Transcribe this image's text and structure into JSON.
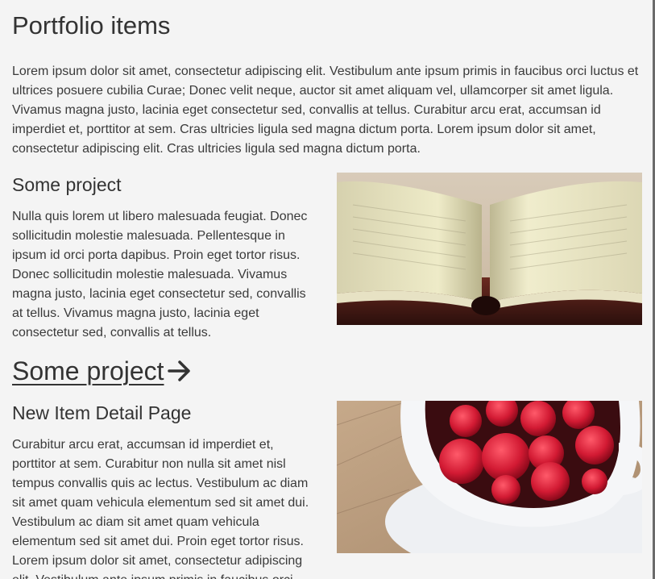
{
  "page": {
    "title": "Portfolio items",
    "intro": "Lorem ipsum dolor sit amet, consectetur adipiscing elit. Vestibulum ante ipsum primis in faucibus orci luctus et ultrices posuere cubilia Curae; Donec velit neque, auctor sit amet aliquam vel, ullamcorper sit amet ligula. Vivamus magna justo, lacinia eget consectetur sed, convallis at tellus. Curabitur arcu erat, accumsan id imperdiet et, porttitor at sem. Cras ultricies ligula sed magna dictum porta. Lorem ipsum dolor sit amet, consectetur adipiscing elit. Cras ultricies ligula sed magna dictum porta."
  },
  "items": [
    {
      "heading": "Some project",
      "body": "Nulla quis lorem ut libero malesuada feugiat. Donec sollicitudin molestie malesuada. Pellentesque in ipsum id orci porta dapibus. Proin eget tortor risus. Donec sollicitudin molestie malesuada. Vivamus magna justo, lacinia eget consectetur sed, convallis at tellus. Vivamus magna justo, lacinia eget consectetur sed, convallis at tellus.",
      "image": "open-book-photo",
      "link_label": "Some project"
    },
    {
      "heading": "New Item Detail Page",
      "body": "Curabitur arcu erat, accumsan id imperdiet et, porttitor at sem. Curabitur non nulla sit amet nisl tempus convallis quis ac lectus. Vestibulum ac diam sit amet quam vehicula elementum sed sit amet dui. Vestibulum ac diam sit amet quam vehicula elementum sed sit amet dui. Proin eget tortor risus. Lorem ipsum dolor sit amet, consectetur adipiscing elit. Vestibulum ante ipsum primis in faucibus orci",
      "image": "raspberries-cup-photo"
    }
  ],
  "icons": {
    "link_arrow": "arrow-right-icon"
  },
  "colors": {
    "background": "#f4f4f4",
    "text": "#333333"
  }
}
